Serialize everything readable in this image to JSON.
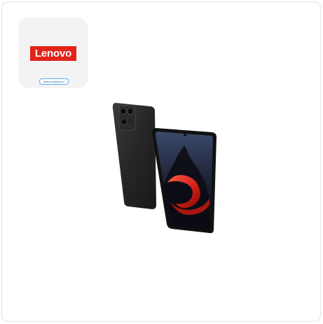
{
  "brand": {
    "name": "Lenovo",
    "url": "www.recashop.ro",
    "accent": "#e2231a"
  },
  "product": {
    "icon": "smartphone-image"
  }
}
